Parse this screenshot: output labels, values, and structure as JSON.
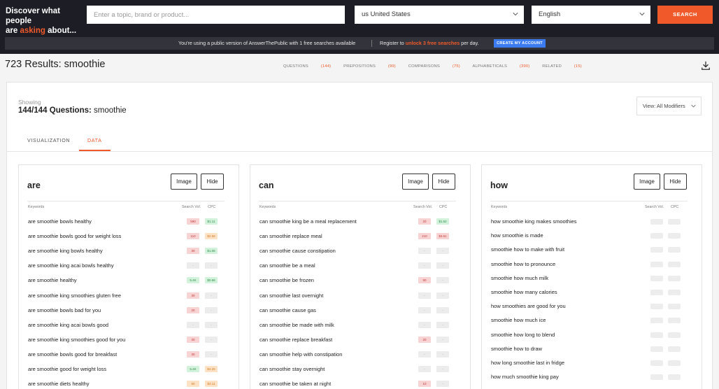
{
  "topbar": {
    "brand_line1": "Discover what people",
    "brand_are": "are",
    "brand_asking": "asking",
    "brand_about": "about...",
    "search_placeholder": "Enter a topic, brand or product...",
    "country": "us United States",
    "language": "English",
    "search_button": "SEARCH"
  },
  "notice": {
    "text1": "You're using a public version of AnswerThePublic with 1 free searches available",
    "text2_prefix": "Register to",
    "text2_highlight": "unlock 3 free searches",
    "text2_suffix": "per day.",
    "create_button": "CREATE MY ACCOUNT"
  },
  "results": {
    "title": "723 Results: smoothie",
    "tabs": [
      {
        "label": "QUESTIONS",
        "count": "(144)"
      },
      {
        "label": "PREPOSITIONS",
        "count": "(99)"
      },
      {
        "label": "COMPARISONS",
        "count": "(75)"
      },
      {
        "label": "ALPHABETICALS",
        "count": "(390)"
      },
      {
        "label": "RELATED",
        "count": "(15)"
      }
    ]
  },
  "panel": {
    "showing": "Showing",
    "count": "144/144 Questions:",
    "keyword": "smoothie",
    "view_select": "View: All Modifiers",
    "tab_visualization": "VISUALIZATION",
    "tab_data": "DATA"
  },
  "columns_common": {
    "image_button": "Image",
    "hide_button": "Hide",
    "hdr_keywords": "Keywords",
    "hdr_search_vol": "Search Vol.",
    "hdr_cpc": "CPC"
  },
  "colors": {
    "accent": "#f05a2a",
    "topbar": "#1d1d26",
    "create_button": "#3d7cf0"
  },
  "columns": [
    {
      "title": "are",
      "rows": [
        {
          "kw": "are smoothie bowls healthy",
          "sv": "590",
          "sv_c": "red",
          "cpc": "$1.11",
          "cpc_c": "green"
        },
        {
          "kw": "are smoothie bowls good for weight loss",
          "sv": "110",
          "sv_c": "red",
          "cpc": "$2.56",
          "cpc_c": "orange"
        },
        {
          "kw": "are smoothie king bowls healthy",
          "sv": "30",
          "sv_c": "red",
          "cpc": "$1.08",
          "cpc_c": "green"
        },
        {
          "kw": "are smoothie king acai bowls healthy",
          "sv": "-",
          "sv_c": "grey",
          "cpc": "-",
          "cpc_c": "grey"
        },
        {
          "kw": "are smoothie healthy",
          "sv": "5.4K",
          "sv_c": "green",
          "cpc": "$0.68",
          "cpc_c": "green"
        },
        {
          "kw": "are smoothie king smoothies gluten free",
          "sv": "30",
          "sv_c": "red",
          "cpc": "-",
          "cpc_c": "grey"
        },
        {
          "kw": "are smoothie bowls bad for you",
          "sv": "20",
          "sv_c": "red",
          "cpc": "-",
          "cpc_c": "grey"
        },
        {
          "kw": "are smoothie king acai bowls good",
          "sv": "-",
          "sv_c": "grey",
          "cpc": "-",
          "cpc_c": "grey"
        },
        {
          "kw": "are smoothie king smoothies good for you",
          "sv": "30",
          "sv_c": "red",
          "cpc": "-",
          "cpc_c": "grey"
        },
        {
          "kw": "are smoothie bowls good for breakfast",
          "sv": "30",
          "sv_c": "red",
          "cpc": "-",
          "cpc_c": "grey"
        },
        {
          "kw": "are smoothie good for weight loss",
          "sv": "5.4K",
          "sv_c": "green",
          "cpc": "$4.25",
          "cpc_c": "orange"
        },
        {
          "kw": "are smoothie diets healthy",
          "sv": "50",
          "sv_c": "orange",
          "cpc": "$3.11",
          "cpc_c": "orange"
        }
      ]
    },
    {
      "title": "can",
      "rows": [
        {
          "kw": "can smoothie king be a meal replacement",
          "sv": "20",
          "sv_c": "red",
          "cpc": "$1.52",
          "cpc_c": "green"
        },
        {
          "kw": "can smoothie replace meal",
          "sv": "210",
          "sv_c": "red",
          "cpc": "$3.61",
          "cpc_c": "red"
        },
        {
          "kw": "can smoothie cause constipation",
          "sv": "-",
          "sv_c": "grey",
          "cpc": "-",
          "cpc_c": "grey"
        },
        {
          "kw": "can smoothie be a meal",
          "sv": "-",
          "sv_c": "grey",
          "cpc": "-",
          "cpc_c": "grey"
        },
        {
          "kw": "can smoothie be frozen",
          "sv": "90",
          "sv_c": "red",
          "cpc": "-",
          "cpc_c": "grey"
        },
        {
          "kw": "can smoothie last overnight",
          "sv": "-",
          "sv_c": "grey",
          "cpc": "-",
          "cpc_c": "grey"
        },
        {
          "kw": "can smoothie cause gas",
          "sv": "-",
          "sv_c": "grey",
          "cpc": "-",
          "cpc_c": "grey"
        },
        {
          "kw": "can smoothie be made with milk",
          "sv": "-",
          "sv_c": "grey",
          "cpc": "-",
          "cpc_c": "grey"
        },
        {
          "kw": "can smoothie replace breakfast",
          "sv": "20",
          "sv_c": "red",
          "cpc": "-",
          "cpc_c": "grey"
        },
        {
          "kw": "can smoothie help with constipation",
          "sv": "-",
          "sv_c": "grey",
          "cpc": "-",
          "cpc_c": "grey"
        },
        {
          "kw": "can smoothie stay overnight",
          "sv": "-",
          "sv_c": "grey",
          "cpc": "-",
          "cpc_c": "grey"
        },
        {
          "kw": "can smoothie be taken at night",
          "sv": "10",
          "sv_c": "red",
          "cpc": "-",
          "cpc_c": "grey"
        }
      ]
    },
    {
      "title": "how",
      "rows": [
        {
          "kw": "how smoothie king makes smoothies"
        },
        {
          "kw": "how smoothie is made"
        },
        {
          "kw": "smoothie how to make with fruit"
        },
        {
          "kw": "smoothie how to pronounce"
        },
        {
          "kw": "smoothie how much milk"
        },
        {
          "kw": "smoothie how many calories"
        },
        {
          "kw": "how smoothies are good for you"
        },
        {
          "kw": "smoothie how much ice"
        },
        {
          "kw": "smoothie how long to blend"
        },
        {
          "kw": "smoothie how to draw"
        },
        {
          "kw": "how long smoothie last in fridge"
        },
        {
          "kw": "how much smoothie king pay"
        }
      ]
    }
  ]
}
